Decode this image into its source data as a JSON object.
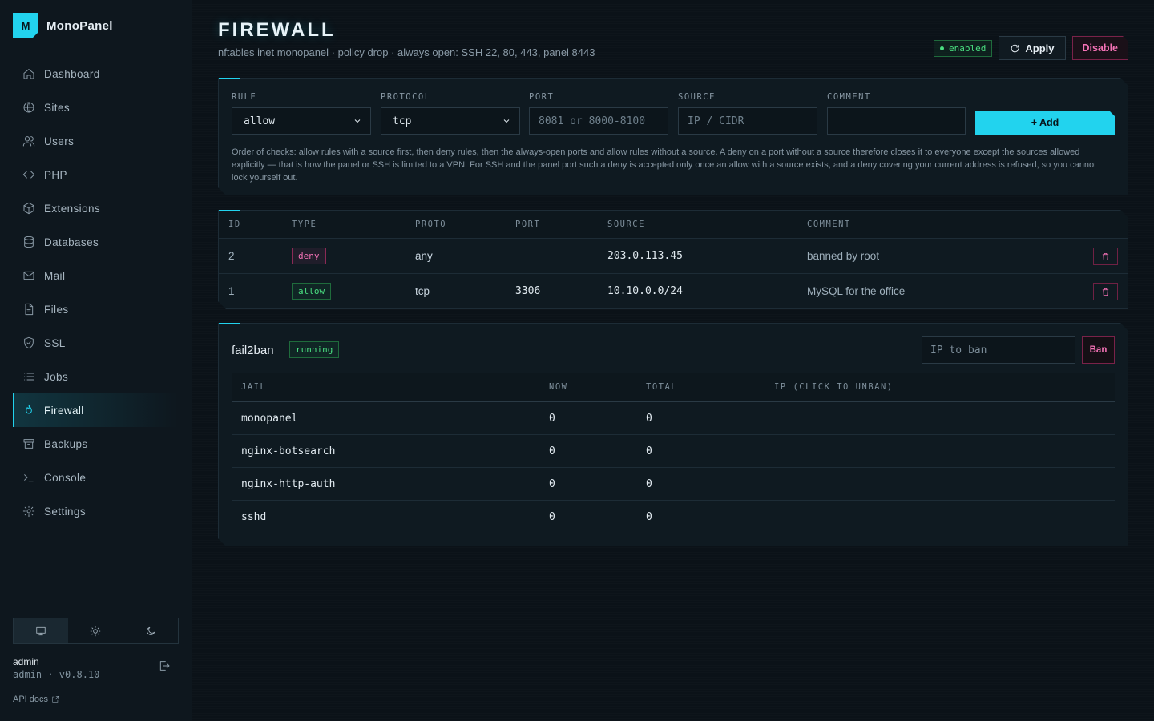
{
  "brand": {
    "logo_letter": "M",
    "name": "MonoPanel"
  },
  "nav": [
    {
      "label": "Dashboard",
      "icon": "home-icon"
    },
    {
      "label": "Sites",
      "icon": "globe-icon"
    },
    {
      "label": "Users",
      "icon": "users-icon"
    },
    {
      "label": "PHP",
      "icon": "code-icon"
    },
    {
      "label": "Extensions",
      "icon": "package-icon"
    },
    {
      "label": "Databases",
      "icon": "database-icon"
    },
    {
      "label": "Mail",
      "icon": "mail-icon"
    },
    {
      "label": "Files",
      "icon": "file-icon"
    },
    {
      "label": "SSL",
      "icon": "shield-icon"
    },
    {
      "label": "Jobs",
      "icon": "list-icon"
    },
    {
      "label": "Firewall",
      "icon": "flame-icon",
      "active": true
    },
    {
      "label": "Backups",
      "icon": "archive-icon"
    },
    {
      "label": "Console",
      "icon": "terminal-icon"
    },
    {
      "label": "Settings",
      "icon": "gear-icon"
    }
  ],
  "theme": {
    "selected": "system",
    "options": [
      "monitor-icon",
      "sun-icon",
      "moon-icon"
    ]
  },
  "user": {
    "name": "admin",
    "role_version": "admin · v0.8.10"
  },
  "api_docs": "API docs",
  "header": {
    "title": "FIREWALL",
    "subtitle": "nftables inet monopanel · policy drop · always open: SSH 22, 80, 443, panel 8443",
    "status": "enabled",
    "apply_label": "Apply",
    "disable_label": "Disable"
  },
  "form": {
    "rule_label": "RULE",
    "rule_value": "allow",
    "protocol_label": "PROTOCOL",
    "protocol_value": "tcp",
    "port_label": "PORT",
    "port_placeholder": "8081 or 8000-8100",
    "source_label": "SOURCE",
    "source_placeholder": "IP / CIDR",
    "comment_label": "COMMENT",
    "comment_value": "",
    "add_label": "+ Add",
    "help": "Order of checks: allow rules with a source first, then deny rules, then the always-open ports and allow rules without a source. A deny on a port without a source therefore closes it to everyone except the sources allowed explicitly — that is how the panel or SSH is limited to a VPN. For SSH and the panel port such a deny is accepted only once an allow with a source exists, and a deny covering your current address is refused, so you cannot lock yourself out."
  },
  "rules": {
    "columns": [
      "ID",
      "TYPE",
      "PROTO",
      "PORT",
      "SOURCE",
      "COMMENT"
    ],
    "rows": [
      {
        "id": "2",
        "type": "deny",
        "proto": "any",
        "port": "",
        "source": "203.0.113.45",
        "comment": "banned by root"
      },
      {
        "id": "1",
        "type": "allow",
        "proto": "tcp",
        "port": "3306",
        "source": "10.10.0.0/24",
        "comment": "MySQL for the office"
      }
    ]
  },
  "fail2ban": {
    "title": "fail2ban",
    "status": "running",
    "ban_placeholder": "IP to ban",
    "ban_label": "Ban",
    "columns": [
      "JAIL",
      "NOW",
      "TOTAL",
      "IP (CLICK TO UNBAN)"
    ],
    "jails": [
      {
        "name": "monopanel",
        "now": "0",
        "total": "0"
      },
      {
        "name": "nginx-botsearch",
        "now": "0",
        "total": "0"
      },
      {
        "name": "nginx-http-auth",
        "now": "0",
        "total": "0"
      },
      {
        "name": "sshd",
        "now": "0",
        "total": "0"
      }
    ]
  },
  "colors": {
    "accent": "#22d3ee",
    "success": "#4ade80",
    "danger": "#f472b6",
    "bg": "#0b1218"
  }
}
